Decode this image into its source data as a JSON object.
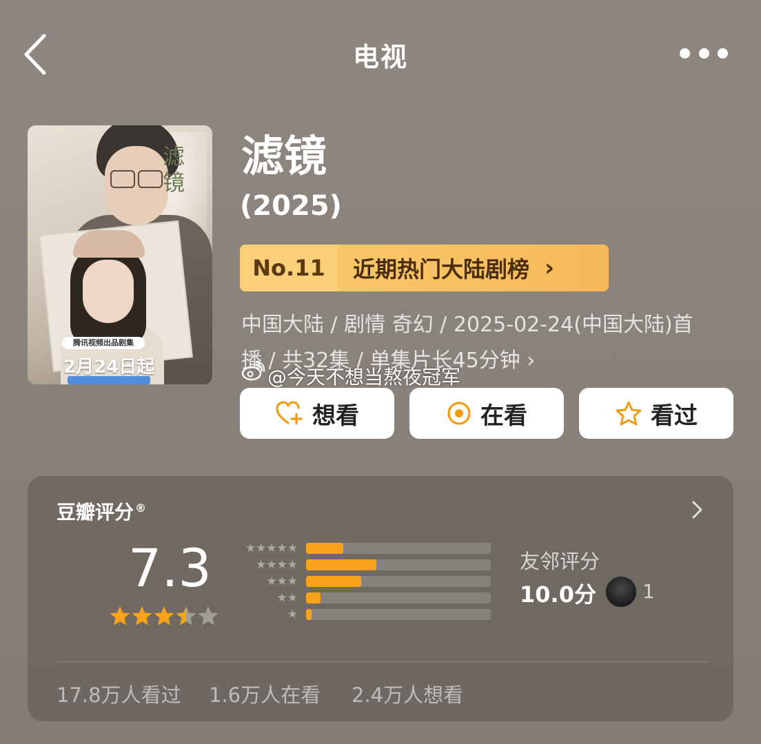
{
  "header": {
    "title": "电视",
    "back_icon": "chevron-left-icon",
    "more_icon": "more-dots-icon"
  },
  "poster": {
    "calligraphy": "滤镜",
    "banner": "腾讯视频出品剧集",
    "date": "2月24日起"
  },
  "show": {
    "title": "滤镜",
    "year": "(2025)",
    "rank": {
      "number": "No.11",
      "label": "近期热门大陆剧榜",
      "chevron": "›"
    },
    "meta_line1": "中国大陆 / 剧情 奇幻 / 2025-02-24(中国大陆)首",
    "meta_line2": "播 / 共32集 / 单集片长45分钟 ›"
  },
  "watermark": {
    "text": "@今天不想当熬夜冠军",
    "icon": "weibo-icon"
  },
  "actions": [
    {
      "label": "想看",
      "icon": "heart-plus-icon"
    },
    {
      "label": "在看",
      "icon": "target-icon"
    },
    {
      "label": "看过",
      "icon": "star-outline-icon"
    }
  ],
  "rating": {
    "title": "豆瓣评分",
    "registered": "®",
    "score": "7.3",
    "star_rating": 3.5,
    "distribution": [
      {
        "stars": "★★★★★",
        "fraction": 0.2
      },
      {
        "stars": "★★★★",
        "fraction": 0.38
      },
      {
        "stars": "★★★",
        "fraction": 0.3
      },
      {
        "stars": "★★",
        "fraction": 0.08
      },
      {
        "stars": "★",
        "fraction": 0.03
      }
    ],
    "friend_label": "友邻评分",
    "friend_score": "10.0分",
    "friend_count": "1"
  },
  "stats": {
    "watched": "17.8万人看过",
    "watching": "1.6万人在看",
    "want": "2.4万人想看"
  },
  "colors": {
    "accent_orange": "#f7a21a",
    "rank_bg": "#f8c768",
    "background": "#8a837b"
  }
}
